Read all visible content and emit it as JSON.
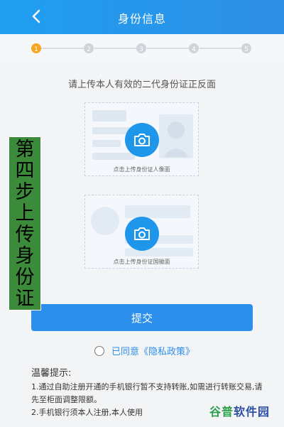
{
  "header": {
    "title": "身份信息"
  },
  "steps": {
    "labels": [
      "1",
      "2",
      "3",
      "4",
      "5"
    ]
  },
  "upload": {
    "instruction": "请上传本人有效的二代身份证正反面",
    "portrait_label": "点击上传身份证人像面",
    "emblem_label": "点击上传身份证国徽面"
  },
  "actions": {
    "submit_label": "提交"
  },
  "agreement": {
    "label": "已同意《隐私政策》"
  },
  "tips": {
    "title": "温馨提示:",
    "item1": "1.通过自助注册开通的手机银行暂不支持转账,如需进行转账交易,请先至柜面调整限额。",
    "item2": "2.手机银行须本人注册,本人使用"
  },
  "overlay": {
    "label": "第四步上传身份证"
  },
  "watermark": {
    "part1": "谷普",
    "part2": "软件园"
  },
  "colors": {
    "primary": "#2d8fec",
    "active_step": "#f5a623",
    "overlay": "#3c8b3b"
  },
  "icons": [
    "back-chevron-icon",
    "camera-icon"
  ]
}
